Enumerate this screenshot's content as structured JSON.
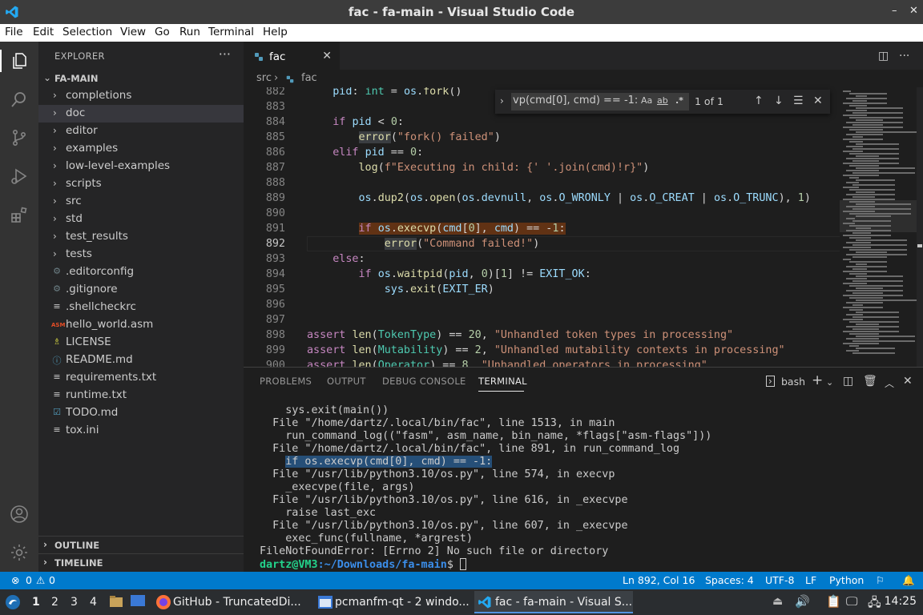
{
  "window": {
    "title": "fac - fa-main - Visual Studio Code",
    "minimize": "–",
    "restore": "▫",
    "close": "✕"
  },
  "menu": [
    "File",
    "Edit",
    "Selection",
    "View",
    "Go",
    "Run",
    "Terminal",
    "Help"
  ],
  "sidebar": {
    "header": "EXPLORER",
    "more": "···",
    "root": "FA-MAIN",
    "items": [
      {
        "label": "completions",
        "type": "folder"
      },
      {
        "label": "doc",
        "type": "folder",
        "selected": true
      },
      {
        "label": "editor",
        "type": "folder"
      },
      {
        "label": "examples",
        "type": "folder"
      },
      {
        "label": "low-level-examples",
        "type": "folder"
      },
      {
        "label": "scripts",
        "type": "folder"
      },
      {
        "label": "src",
        "type": "folder"
      },
      {
        "label": "std",
        "type": "folder"
      },
      {
        "label": "test_results",
        "type": "folder"
      },
      {
        "label": "tests",
        "type": "folder"
      },
      {
        "label": ".editorconfig",
        "type": "gear"
      },
      {
        "label": ".gitignore",
        "type": "gear"
      },
      {
        "label": ".shellcheckrc",
        "type": "lines"
      },
      {
        "label": "hello_world.asm",
        "type": "asm"
      },
      {
        "label": "LICENSE",
        "type": "license"
      },
      {
        "label": "README.md",
        "type": "info"
      },
      {
        "label": "requirements.txt",
        "type": "lines"
      },
      {
        "label": "runtime.txt",
        "type": "lines"
      },
      {
        "label": "TODO.md",
        "type": "check"
      },
      {
        "label": "tox.ini",
        "type": "lines"
      }
    ],
    "outline": "OUTLINE",
    "timeline": "TIMELINE"
  },
  "editor": {
    "tab_label": "fac",
    "breadcrumb": [
      "src",
      "fac"
    ],
    "find": {
      "query": "vp(cmd[0], cmd) == -1:",
      "opt_case": "Aa",
      "opt_word": "ab",
      "opt_regex": ".*",
      "count": "1 of 1"
    }
  },
  "code": [
    {
      "n": "882",
      "t": "    pid: int = os.fork()"
    },
    {
      "n": "883",
      "t": ""
    },
    {
      "n": "884",
      "t": "    if pid < 0:"
    },
    {
      "n": "885",
      "t": "        error(\"fork() failed\")"
    },
    {
      "n": "886",
      "t": "    elif pid == 0:"
    },
    {
      "n": "887",
      "t": "        log(f\"Executing in child: {' '.join(cmd)!r}\")"
    },
    {
      "n": "888",
      "t": ""
    },
    {
      "n": "889",
      "t": "        os.dup2(os.open(os.devnull, os.O_WRONLY | os.O_CREAT | os.O_TRUNC), 1)"
    },
    {
      "n": "890",
      "t": ""
    },
    {
      "n": "891",
      "t": "        if os.execvp(cmd[0], cmd) == -1:"
    },
    {
      "n": "892",
      "t": "            error(\"Command failed!\")"
    },
    {
      "n": "893",
      "t": "    else:"
    },
    {
      "n": "894",
      "t": "        if os.waitpid(pid, 0)[1] != EXIT_OK:"
    },
    {
      "n": "895",
      "t": "            sys.exit(EXIT_ER)"
    },
    {
      "n": "896",
      "t": ""
    },
    {
      "n": "897",
      "t": ""
    },
    {
      "n": "898",
      "t": "assert len(TokenType) == 20, \"Unhandled token types in processing\""
    },
    {
      "n": "899",
      "t": "assert len(Mutability) == 2, \"Unhandled mutability contexts in processing\""
    },
    {
      "n": "900",
      "t": "assert len(Operator) == 8, \"Unhandled operators in processing\""
    }
  ],
  "panel": {
    "tabs": [
      "PROBLEMS",
      "OUTPUT",
      "DEBUG CONSOLE",
      "TERMINAL"
    ],
    "shell": "bash",
    "terminal": [
      "    sys.exit(main())",
      "  File \"/home/dartz/.local/bin/fac\", line 1513, in main",
      "    run_command_log((\"fasm\", asm_name, bin_name, *flags[\"asm-flags\"]))",
      "  File \"/home/dartz/.local/bin/fac\", line 891, in run_command_log",
      "    if os.execvp(cmd[0], cmd) == -1:",
      "  File \"/usr/lib/python3.10/os.py\", line 574, in execvp",
      "    _execvpe(file, args)",
      "  File \"/usr/lib/python3.10/os.py\", line 616, in _execvpe",
      "    raise last_exc",
      "  File \"/usr/lib/python3.10/os.py\", line 607, in _execvpe",
      "    exec_func(fullname, *argrest)",
      "FileNotFoundError: [Errno 2] No such file or directory"
    ],
    "prompt_user": "dartz@VM3",
    "prompt_path": ":~/Downloads/fa-main",
    "prompt_symbol": "$ "
  },
  "status": {
    "errors": "0",
    "warnings": "0",
    "position": "Ln 892, Col 16",
    "spaces": "Spaces: 4",
    "encoding": "UTF-8",
    "eol": "LF",
    "language": "Python"
  },
  "taskbar": {
    "workspaces": [
      "1",
      "2",
      "3",
      "4"
    ],
    "tasks": [
      {
        "label": "GitHub - TruncatedDi..."
      },
      {
        "label": "pcmanfm-qt - 2 windo..."
      },
      {
        "label": "fac - fa-main - Visual S..."
      }
    ],
    "clock": "14:25"
  },
  "colors": {
    "accent": "#007acc",
    "activity_bar": "#333333",
    "sidebar": "#252526",
    "editor_bg": "#1e1e1e"
  }
}
